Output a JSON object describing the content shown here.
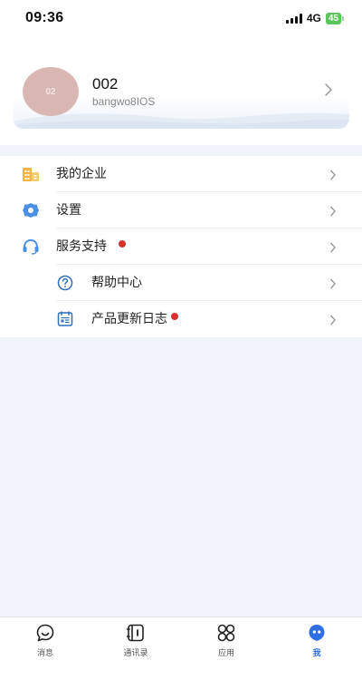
{
  "status_bar": {
    "time": "09:36",
    "network": "4G",
    "battery": "45"
  },
  "profile": {
    "avatar_text": "02",
    "name": "002",
    "subtitle": "bangwo8IOS"
  },
  "menu": {
    "items": [
      {
        "label": "我的企业",
        "icon": "building-icon"
      },
      {
        "label": "设置",
        "icon": "gear-icon"
      },
      {
        "label": "服务支持",
        "icon": "headset-icon",
        "badge_dot": true
      },
      {
        "label": "帮助中心",
        "icon": "question-icon"
      },
      {
        "label": "产品更新日志",
        "icon": "log-icon",
        "badge_dot": true
      }
    ]
  },
  "tabbar": {
    "tabs": [
      {
        "label": "消息",
        "icon": "chat-bubble-icon"
      },
      {
        "label": "通讯录",
        "icon": "contacts-book-icon"
      },
      {
        "label": "应用",
        "icon": "apps-grid-icon"
      },
      {
        "label": "我",
        "icon": "profile-icon",
        "active": true
      }
    ]
  },
  "colors": {
    "accent": "#2f6fe4",
    "badge": "#d9312d",
    "icon_blue": "#4a8ee6",
    "icon_orange": "#f2b640"
  }
}
